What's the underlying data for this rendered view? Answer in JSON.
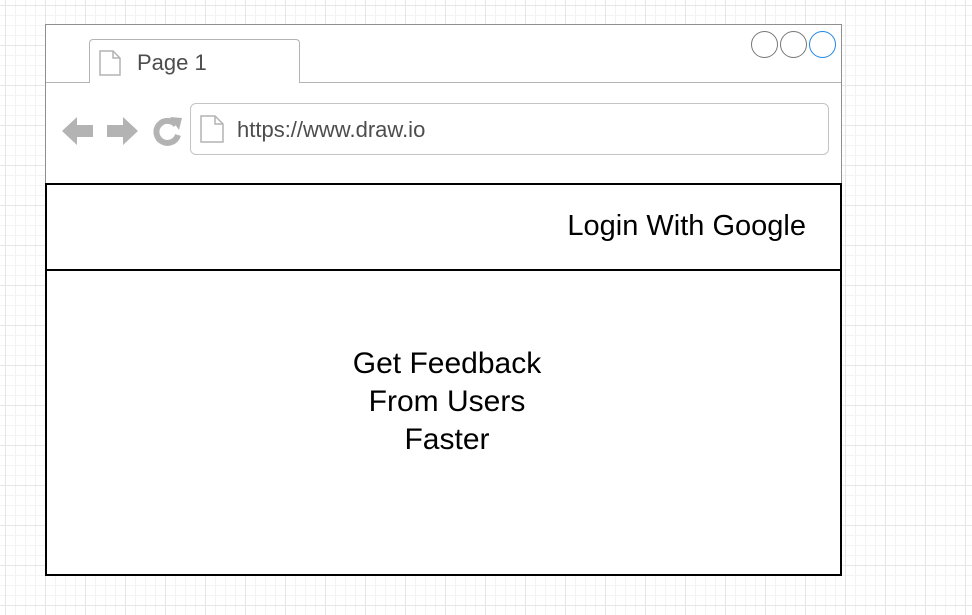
{
  "browser": {
    "tab": {
      "label": "Page 1",
      "icon": "document-icon"
    },
    "window_controls": [
      "minimize-circle",
      "maximize-circle",
      "close-circle"
    ],
    "nav_icons": [
      "back-arrow-icon",
      "forward-arrow-icon",
      "refresh-icon"
    ],
    "address_bar": {
      "url": "https://www.draw.io",
      "icon": "document-icon"
    },
    "accent_color": "#1e88e5"
  },
  "header": {
    "login_label": "Login With Google"
  },
  "main": {
    "hero_lines": [
      "Get Feedback",
      "From Users",
      "Faster"
    ]
  }
}
